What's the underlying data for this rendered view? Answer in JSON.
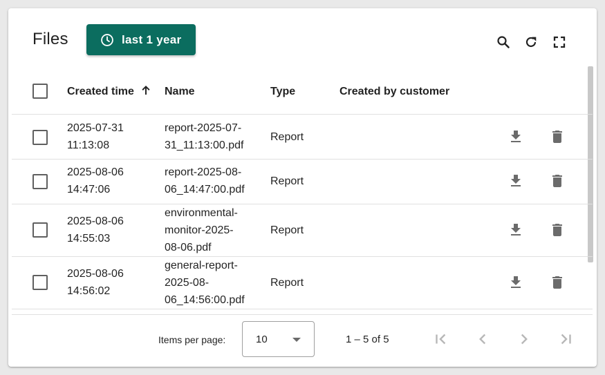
{
  "header": {
    "title": "Files",
    "time_filter_label": "last 1 year",
    "toolbar_icons": [
      "search-icon",
      "refresh-icon",
      "fullscreen-icon"
    ]
  },
  "table": {
    "columns": [
      "Created time",
      "Name",
      "Type",
      "Created by customer"
    ],
    "sort": {
      "column": "Created time",
      "direction": "ascending"
    },
    "rows": [
      {
        "time_date": "2025-07-31",
        "time_clock": "11:13:08",
        "name_lines": [
          "report-2025-07-",
          "31_11:13:00.pdf"
        ],
        "type": "Report",
        "customer": ""
      },
      {
        "time_date": "2025-08-06",
        "time_clock": "14:47:06",
        "name_lines": [
          "report-2025-08-",
          "06_14:47:00.pdf"
        ],
        "type": "Report",
        "customer": ""
      },
      {
        "time_date": "2025-08-06",
        "time_clock": "14:55:03",
        "name_lines": [
          "environmental-",
          "monitor-2025-",
          "08-06.pdf"
        ],
        "type": "Report",
        "customer": ""
      },
      {
        "time_date": "2025-08-06",
        "time_clock": "14:56:02",
        "name_lines": [
          "general-report-",
          "2025-08-",
          "06_14:56:00.pdf"
        ],
        "type": "Report",
        "customer": ""
      }
    ]
  },
  "pagination": {
    "items_per_page_label": "Items per page:",
    "items_per_page_value": "10",
    "range_label": "1 – 5 of 5"
  },
  "colors": {
    "accent": "#0b6d5f",
    "icon": "#6b6b6b",
    "disabled_icon": "#b7b7b7"
  }
}
